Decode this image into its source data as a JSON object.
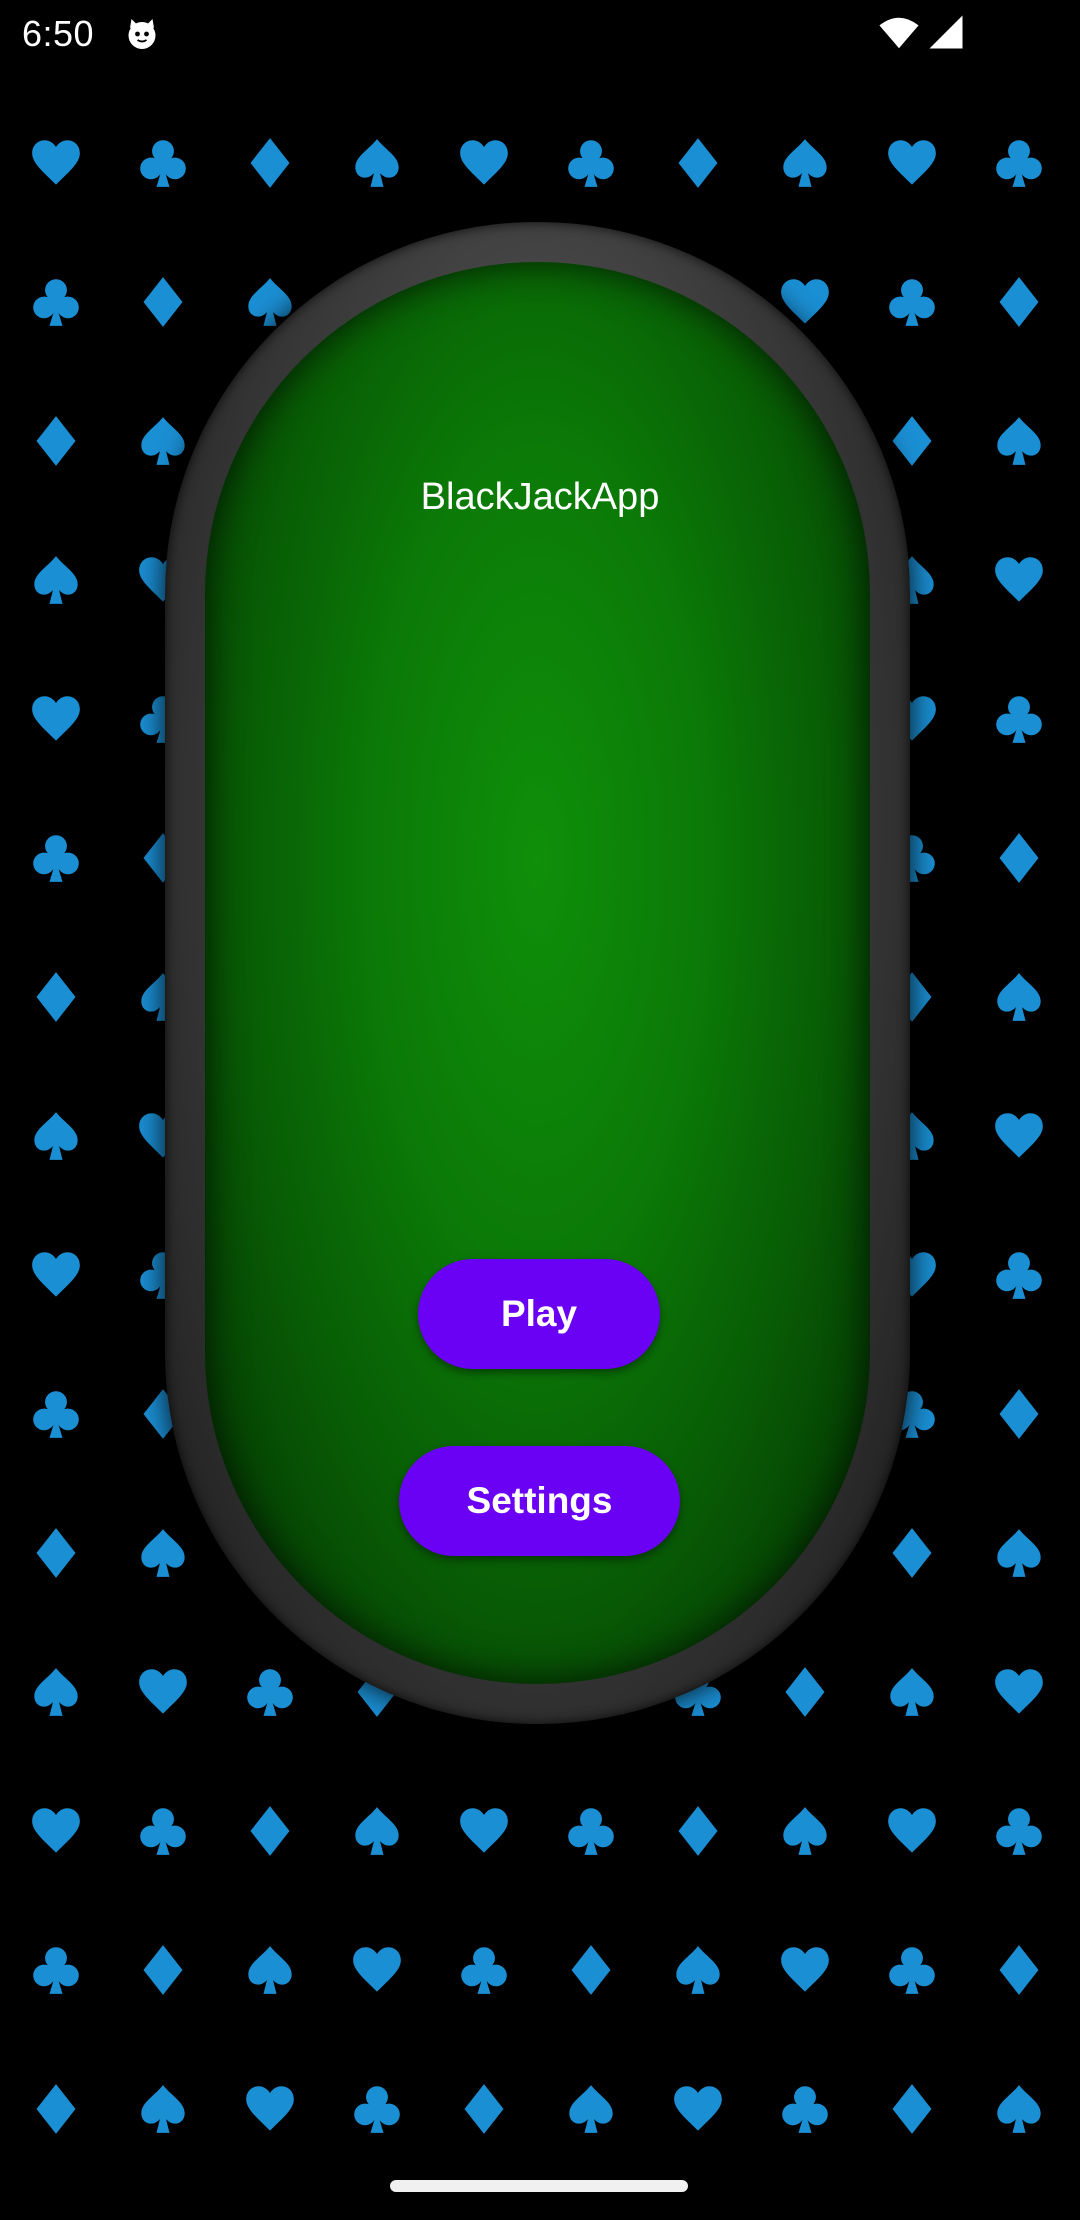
{
  "status_bar": {
    "time": "6:50",
    "app_icon": "cat-face-icon",
    "wifi_icon": "wifi-icon",
    "signal_icon": "cell-signal-icon"
  },
  "background": {
    "pattern": "card-suits",
    "suit_icons": [
      "spade-icon",
      "heart-icon",
      "club-icon",
      "diamond-icon"
    ],
    "suit_color": "#1b8fd4"
  },
  "table": {
    "felt_color": "#0b7a07",
    "rim_color": "#3a3a3a"
  },
  "main": {
    "title": "BlackJackApp",
    "play_label": "Play",
    "settings_label": "Settings",
    "button_color": "#6a00f4"
  }
}
